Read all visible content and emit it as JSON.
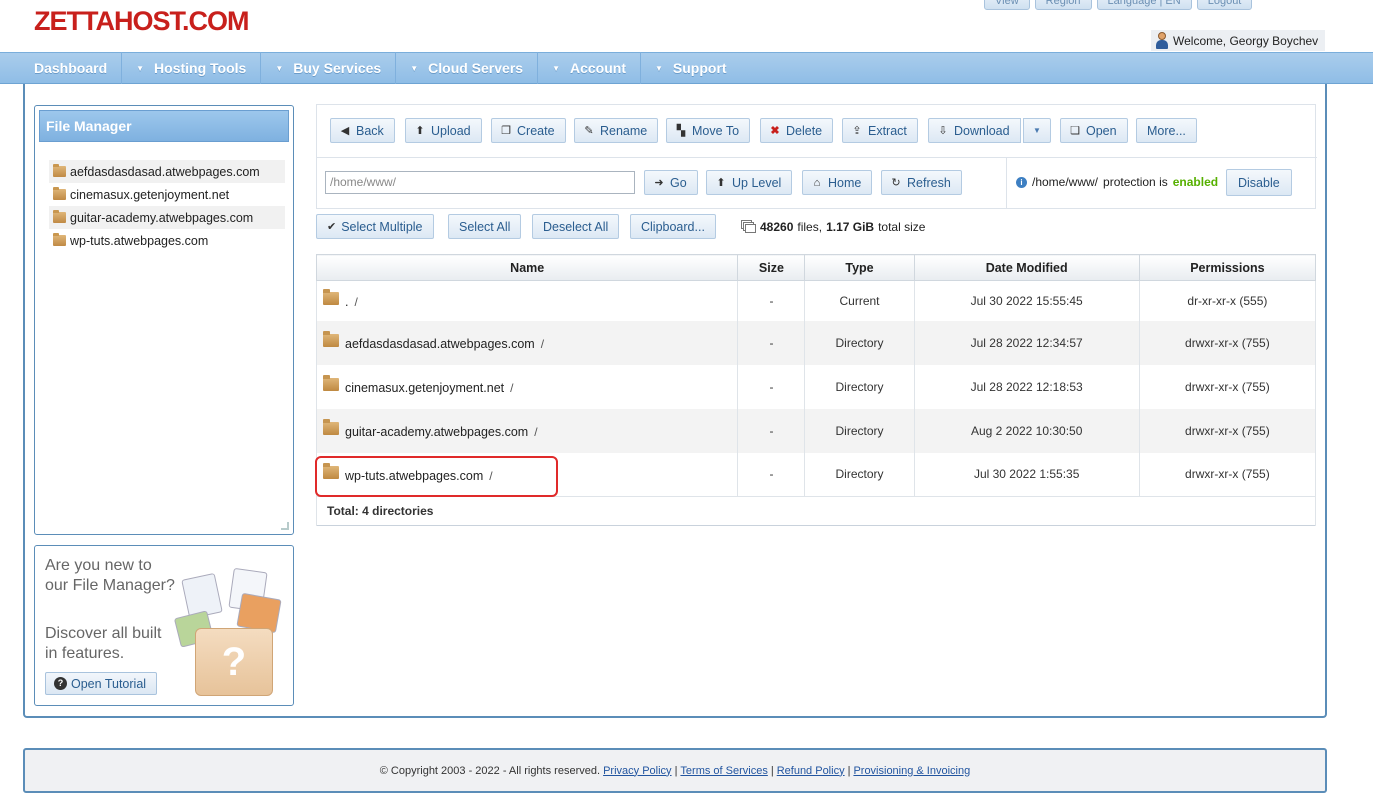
{
  "header": {
    "logo": "ZETTAHOST.COM",
    "top_buttons": [
      "View",
      "Region",
      "Language | EN",
      "Logout"
    ],
    "welcome": "Welcome, Georgy Boychev"
  },
  "nav": {
    "items": [
      "Dashboard",
      "Hosting Tools",
      "Buy Services",
      "Cloud Servers",
      "Account",
      "Support"
    ]
  },
  "sidebar": {
    "title": "File Manager",
    "tree": [
      "aefdasdasdasad.atwebpages.com",
      "cinemasux.getenjoyment.net",
      "guitar-academy.atwebpages.com",
      "wp-tuts.atwebpages.com"
    ]
  },
  "tutorial": {
    "line1": "Are you new to our File Manager?",
    "line2": "Discover all built in features.",
    "button": "Open Tutorial"
  },
  "toolbar": {
    "back": "Back",
    "upload": "Upload",
    "create": "Create",
    "rename": "Rename",
    "move_to": "Move To",
    "delete": "Delete",
    "extract": "Extract",
    "download": "Download",
    "open": "Open",
    "more": "More..."
  },
  "path_bar": {
    "path": "/home/www/",
    "go": "Go",
    "up_level": "Up Level",
    "home": "Home",
    "refresh": "Refresh"
  },
  "protection": {
    "path": "/home/www/",
    "text": "protection is",
    "status": "enabled",
    "button": "Disable"
  },
  "selection": {
    "select_multiple": "Select Multiple",
    "select_all": "Select All",
    "deselect_all": "Deselect All",
    "clipboard": "Clipboard..."
  },
  "stats": {
    "files": "48260",
    "files_label": "files,",
    "size": "1.17 GiB",
    "size_label": "total size"
  },
  "table": {
    "columns": [
      "Name",
      "Size",
      "Type",
      "Date Modified",
      "Permissions"
    ],
    "rows": [
      {
        "name": ".",
        "size": "-",
        "type": "Current",
        "modified": "Jul 30 2022 15:55:45",
        "perms": "dr-xr-xr-x (555)"
      },
      {
        "name": "aefdasdasdasad.atwebpages.com",
        "size": "-",
        "type": "Directory",
        "modified": "Jul 28 2022 12:34:57",
        "perms": "drwxr-xr-x (755)"
      },
      {
        "name": "cinemasux.getenjoyment.net",
        "size": "-",
        "type": "Directory",
        "modified": "Jul 28 2022 12:18:53",
        "perms": "drwxr-xr-x (755)"
      },
      {
        "name": "guitar-academy.atwebpages.com",
        "size": "-",
        "type": "Directory",
        "modified": "Aug 2 2022 10:30:50",
        "perms": "drwxr-xr-x (755)"
      },
      {
        "name": "wp-tuts.atwebpages.com",
        "size": "-",
        "type": "Directory",
        "modified": "Jul 30 2022 1:55:35",
        "perms": "drwxr-xr-x (755)"
      }
    ],
    "total": "Total: 4 directories"
  },
  "footer": {
    "copyright": "© Copyright 2003 - 2022 - All rights reserved.",
    "links": [
      "Privacy Policy",
      "Terms of Services",
      "Refund Policy",
      "Provisioning & Invoicing"
    ]
  },
  "colors": {
    "brand_red": "#c8201c",
    "nav_blue": "#8fbde6",
    "link_blue": "#2a5d8f",
    "enabled_green": "#56b000",
    "highlight_red": "#e02a2a"
  }
}
